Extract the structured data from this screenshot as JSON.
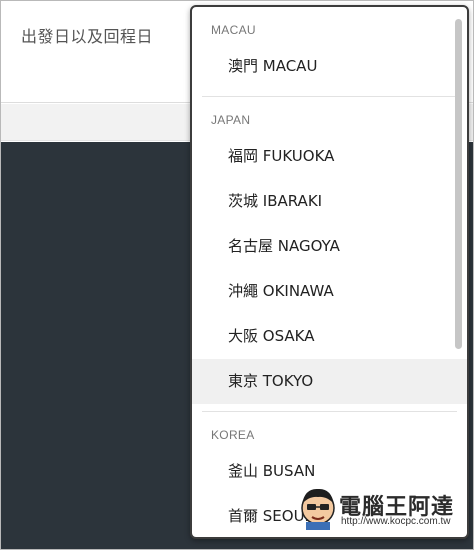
{
  "form": {
    "date_label": "出發日以及回程日"
  },
  "dropdown": {
    "groups": [
      {
        "label": "MACAU",
        "options": [
          {
            "text": "澳門 MACAU",
            "selected": false
          }
        ]
      },
      {
        "label": "JAPAN",
        "options": [
          {
            "text": "福岡 FUKUOKA",
            "selected": false
          },
          {
            "text": "茨城 IBARAKI",
            "selected": false
          },
          {
            "text": "名古屋 NAGOYA",
            "selected": false
          },
          {
            "text": "沖繩 OKINAWA",
            "selected": false
          },
          {
            "text": "大阪 OSAKA",
            "selected": false
          },
          {
            "text": "東京 TOKYO",
            "selected": true
          }
        ]
      },
      {
        "label": "KOREA",
        "options": [
          {
            "text": "釜山 BUSAN",
            "selected": false
          },
          {
            "text": "首爾 SEOUL",
            "selected": false
          }
        ]
      }
    ]
  },
  "watermark": {
    "title": "電腦王阿達",
    "url": "http://www.kocpc.com.tw"
  },
  "colors": {
    "dark_background": "#2c343b",
    "highlight": "#f0f0f0"
  }
}
